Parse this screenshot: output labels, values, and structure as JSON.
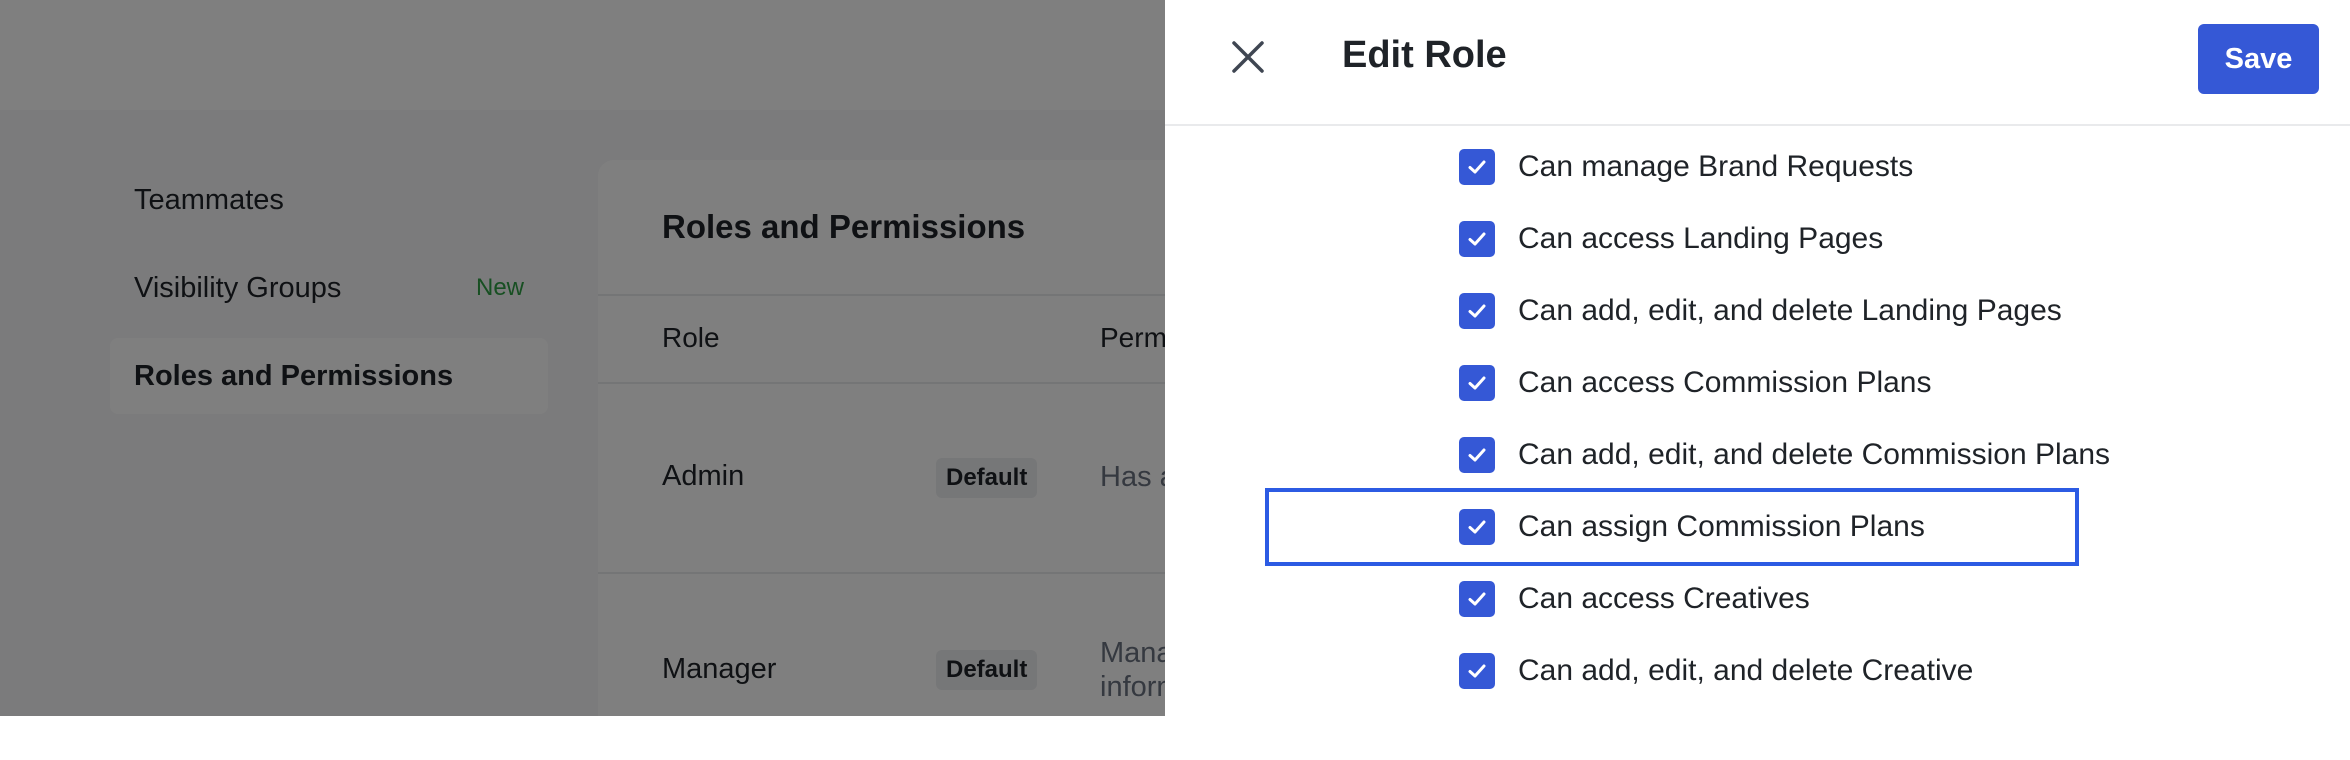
{
  "sidebar": {
    "items": [
      {
        "label": "Teammates"
      },
      {
        "label": "Visibility Groups",
        "badge": "New"
      },
      {
        "label": "Roles and Permissions",
        "active": true
      }
    ]
  },
  "card": {
    "title": "Roles and Permissions",
    "columns": [
      "Role",
      "Perm"
    ],
    "rows": [
      {
        "role": "Admin",
        "badge": "Default",
        "permissions": [
          "Has a"
        ]
      },
      {
        "role": "Manager",
        "badge": "Default",
        "permissions": [
          "Mana",
          "inforn"
        ]
      }
    ]
  },
  "drawer": {
    "title": "Edit Role",
    "save_label": "Save",
    "permissions": [
      {
        "label": "Can manage Brand Requests",
        "checked": true
      },
      {
        "label": "Can access Landing Pages",
        "checked": true
      },
      {
        "label": "Can add, edit, and delete Landing Pages",
        "checked": true
      },
      {
        "label": "Can access Commission Plans",
        "checked": true
      },
      {
        "label": "Can add, edit, and delete Commission Plans",
        "checked": true
      },
      {
        "label": "Can assign Commission Plans",
        "checked": true,
        "highlighted": true
      },
      {
        "label": "Can access Creatives",
        "checked": true
      },
      {
        "label": "Can add, edit, and delete Creative",
        "checked": true
      }
    ]
  },
  "colors": {
    "accent": "#3558d6",
    "highlight_border": "#2c5be3",
    "new_badge": "#2f9e44",
    "overlay": "rgba(0,0,0,0.5)"
  },
  "icons": {
    "close": "close-icon",
    "checkbox": "check-icon"
  }
}
